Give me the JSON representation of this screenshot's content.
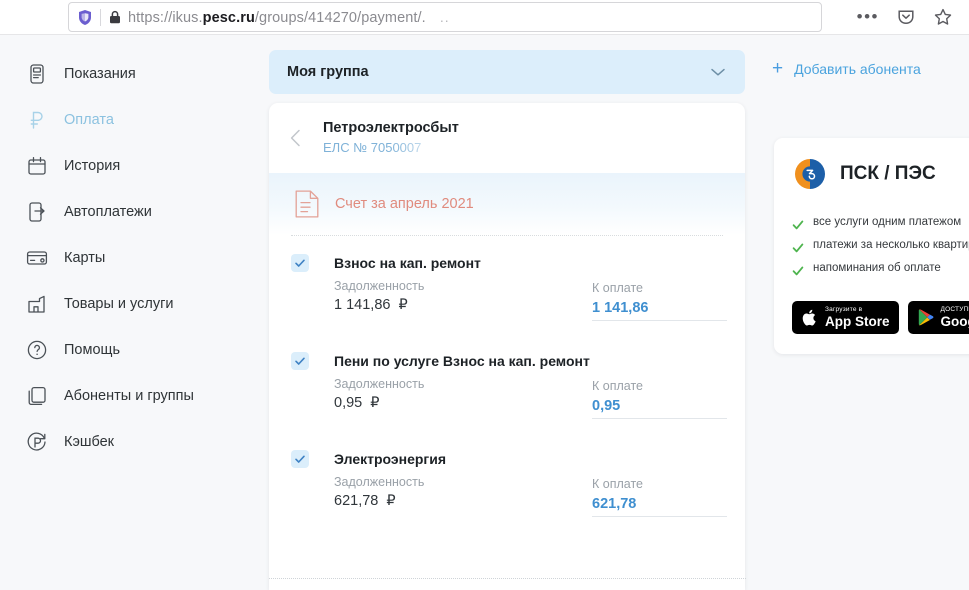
{
  "browser": {
    "url_prefix": "https://ikus.",
    "url_domain": "pesc.ru",
    "url_suffix": "/groups/414270/payment/.",
    "url_overflow": "..",
    "shield_icon": "shield-icon",
    "lock_icon": "lock-icon",
    "menu_icon": "three-dots-icon",
    "pocket_icon": "pocket-icon",
    "bookmark_icon": "star-icon"
  },
  "sidebar": {
    "items": [
      {
        "label": "Показания",
        "icon": "meter-icon",
        "active": false
      },
      {
        "label": "Оплата",
        "icon": "ruble-icon",
        "active": true
      },
      {
        "label": "История",
        "icon": "calendar-icon",
        "active": false
      },
      {
        "label": "Автоплатежи",
        "icon": "autopay-icon",
        "active": false
      },
      {
        "label": "Карты",
        "icon": "card-icon",
        "active": false
      },
      {
        "label": "Товары и услуги",
        "icon": "store-icon",
        "active": false
      },
      {
        "label": "Помощь",
        "icon": "question-icon",
        "active": false
      },
      {
        "label": "Абоненты и группы",
        "icon": "layers-icon",
        "active": false
      },
      {
        "label": "Кэшбек",
        "icon": "cashback-icon",
        "active": false
      }
    ]
  },
  "group_select": {
    "label": "Моя группа",
    "chevron_icon": "chevron-down-icon"
  },
  "payment_card": {
    "back_icon": "chevron-left-icon",
    "provider_name": "Петроэлектросбыт",
    "provider_account": "ЕЛС № 7050007",
    "invoice_icon": "invoice-doc-icon",
    "invoice_title": "Счет за апрель 2021",
    "labels": {
      "debt": "Задолженность",
      "to_pay": "К оплате",
      "currency": "₽"
    },
    "services": [
      {
        "name": "Взнос на кап. ремонт",
        "debt": "1 141,86",
        "to_pay": "1 141,86",
        "checked": true
      },
      {
        "name": "Пени по услуге Взнос на кап. ремонт",
        "debt": "0,95",
        "to_pay": "0,95",
        "checked": true
      },
      {
        "name": "Электроэнергия",
        "debt": "621,78",
        "to_pay": "621,78",
        "checked": true
      }
    ]
  },
  "right_panel": {
    "add_subscriber_label": "Добавить абонента",
    "add_icon": "plus-icon",
    "promo": {
      "logo_icon": "psk-logo-icon",
      "title": "ПСК / ПЭС",
      "features": [
        "все услуги одним платежом",
        "платежи за несколько квартир",
        "напоминания об оплате"
      ],
      "badges": [
        {
          "sup": "Загрузите в",
          "main": "App Store",
          "icon": "apple-icon"
        },
        {
          "sup": "ДОСТУПНО В",
          "main": "Google Play",
          "icon": "google-play-icon"
        }
      ]
    }
  },
  "colors": {
    "accent_blue": "#3f8fd0",
    "link_blue": "#4aa3de",
    "active_nav": "#8cc2e0",
    "invoice_red": "#e08b7e",
    "check_green": "#4eb44e",
    "page_bg": "#f7f8fa"
  }
}
